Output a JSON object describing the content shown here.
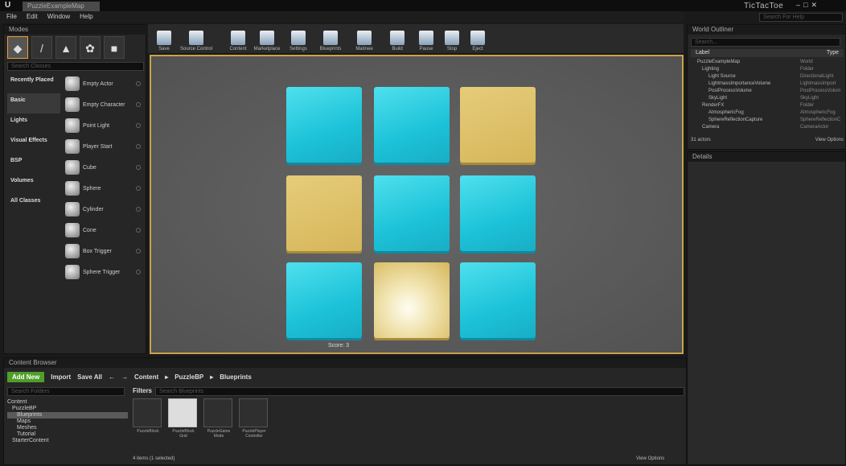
{
  "titlebar": {
    "tab": "PuzzleExampleMap",
    "project": "TicTacToe",
    "search_placeholder": "Search For Help"
  },
  "menu": [
    "File",
    "Edit",
    "Window",
    "Help"
  ],
  "modes": {
    "title": "Modes",
    "search_placeholder": "Search Classes",
    "categories": [
      "Recently Placed",
      "Basic",
      "Lights",
      "Visual Effects",
      "BSP",
      "Volumes",
      "All Classes"
    ],
    "items": [
      "Empty Actor",
      "Empty Character",
      "Point Light",
      "Player Start",
      "Cube",
      "Sphere",
      "Cylinder",
      "Cone",
      "Box Trigger",
      "Sphere Trigger"
    ]
  },
  "toolbar": [
    "Save",
    "Source Control",
    "Content",
    "Marketplace",
    "Settings",
    "Blueprints",
    "Matinee",
    "Build",
    "Pause",
    "Stop",
    "Eject"
  ],
  "viewport": {
    "tiles": [
      "blue",
      "blue",
      "gold",
      "gold",
      "blue",
      "blue",
      "blue",
      "glow",
      "blue"
    ],
    "score": "Score: 3"
  },
  "outliner": {
    "title": "World Outliner",
    "search_placeholder": "Search...",
    "col_label": "Label",
    "col_type": "Type",
    "rows": [
      {
        "label": "PuzzleExampleMap",
        "type": "World"
      },
      {
        "label": "Lighting",
        "type": "Folder"
      },
      {
        "label": "Light Source",
        "type": "DirectionalLight"
      },
      {
        "label": "LightmassImportanceVolume",
        "type": "LightmassImport"
      },
      {
        "label": "PostProcessVolume",
        "type": "PostProcessVolum"
      },
      {
        "label": "SkyLight",
        "type": "SkyLight"
      },
      {
        "label": "RenderFX",
        "type": "Folder"
      },
      {
        "label": "AtmosphericFog",
        "type": "AtmosphericFog"
      },
      {
        "label": "SphereReflectionCapture",
        "type": "SphereReflectionC"
      },
      {
        "label": "Camera",
        "type": "CameraActor"
      }
    ],
    "count": "31 actors",
    "view_options": "View Options"
  },
  "details": {
    "title": "Details"
  },
  "content_browser": {
    "title": "Content Browser",
    "add_new": "Add New",
    "import": "Import",
    "save_all": "Save All",
    "breadcrumb": [
      "Content",
      "PuzzleBP",
      "Blueprints"
    ],
    "search_folders": "Search Folders",
    "filters": "Filters",
    "search_assets": "Search Blueprints",
    "tree": [
      "Content",
      "PuzzleBP",
      "Blueprints",
      "Maps",
      "Meshes",
      "Tutorial",
      "StarterContent"
    ],
    "assets": [
      "PuzzleBlock",
      "PuzzleBlock Grid",
      "PuzzleGame Mode",
      "PuzzlePlayer Controller"
    ],
    "status": "4 items (1 selected)",
    "view_options": "View Options"
  }
}
